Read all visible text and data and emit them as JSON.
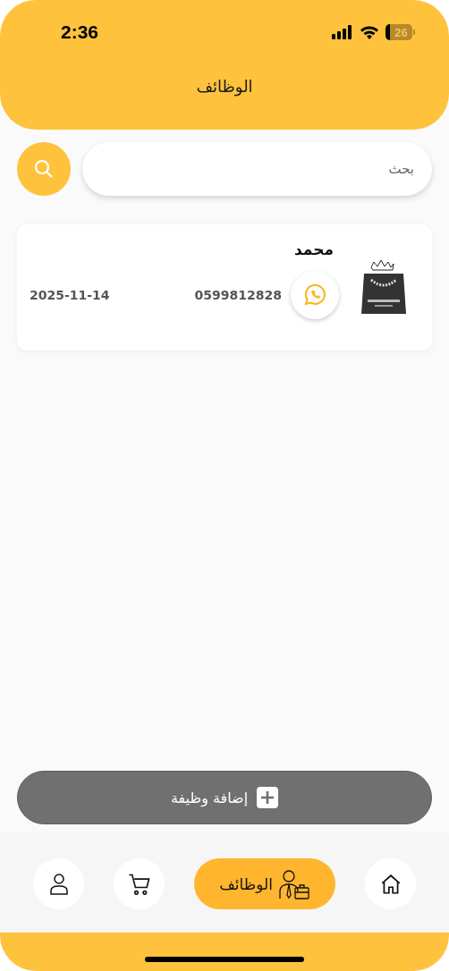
{
  "status_bar": {
    "time": "2:36",
    "battery": "26"
  },
  "header": {
    "title": "الوظائف"
  },
  "search": {
    "placeholder": "بحث"
  },
  "jobs": [
    {
      "name": "محمد",
      "phone": "0599812828",
      "date": "2025-11-14"
    }
  ],
  "add_button": {
    "label": "إضافة وظيفة"
  },
  "bottom_nav": [
    {
      "kind": "home",
      "selected": false
    },
    {
      "kind": "jobs",
      "label": "الوظائف",
      "selected": true
    },
    {
      "kind": "cart",
      "selected": false
    },
    {
      "kind": "profile",
      "selected": false
    }
  ]
}
